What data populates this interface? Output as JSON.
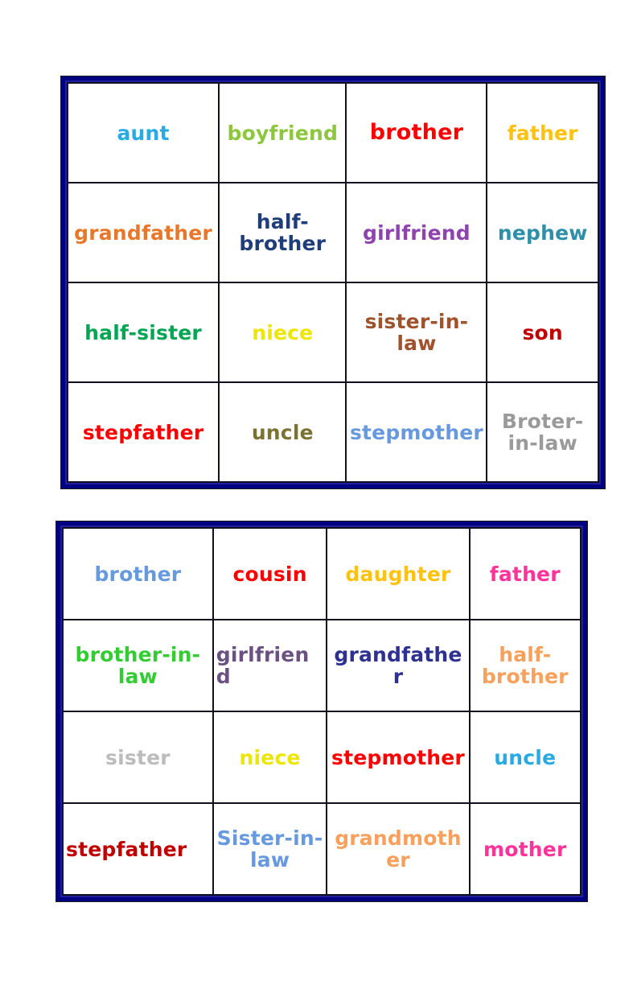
{
  "document": {
    "kind": "vocabulary-bingo-cards",
    "background_color": "#ffffff",
    "card_border_color": "#000080",
    "cell_border_color": "#101020"
  },
  "cards": [
    {
      "id": "card-1",
      "rows": [
        [
          {
            "text": "aunt",
            "color": "#29aae2",
            "align": "center",
            "size": "md"
          },
          {
            "text": "boyfriend",
            "color": "#8dc63f",
            "align": "center",
            "size": "md"
          },
          {
            "text": "brother",
            "color": "#ff0000",
            "align": "center",
            "size": "lg"
          },
          {
            "text": "father",
            "color": "#ffc20e",
            "align": "center",
            "size": "md"
          }
        ],
        [
          {
            "text": "grandfather",
            "color": "#e8772a",
            "align": "center",
            "size": "md"
          },
          {
            "text": "half-brother",
            "color": "#1f3d7a",
            "align": "center",
            "size": "md"
          },
          {
            "text": "girlfriend",
            "color": "#8e44ad",
            "align": "center",
            "size": "md"
          },
          {
            "text": "nephew",
            "color": "#2e8fa8",
            "align": "center",
            "size": "md"
          }
        ],
        [
          {
            "text": "half-sister",
            "color": "#00a651",
            "align": "center",
            "size": "md"
          },
          {
            "text": "niece",
            "color": "#ede600",
            "align": "center",
            "size": "md"
          },
          {
            "text": "sister-in-law",
            "color": "#a0522d",
            "align": "center",
            "size": "md"
          },
          {
            "text": "son",
            "color": "#c00000",
            "align": "center",
            "size": "md"
          }
        ],
        [
          {
            "text": "stepfather",
            "color": "#ff0000",
            "align": "center",
            "size": "md"
          },
          {
            "text": "uncle",
            "color": "#7a7333",
            "align": "center",
            "size": "md"
          },
          {
            "text": "stepmother",
            "color": "#6699dd",
            "align": "center",
            "size": "md"
          },
          {
            "text": "Broter-in-law",
            "color": "#9a9a9a",
            "align": "center",
            "size": "md"
          }
        ]
      ]
    },
    {
      "id": "card-2",
      "rows": [
        [
          {
            "text": "brother",
            "color": "#6699dd",
            "align": "center",
            "size": "md"
          },
          {
            "text": "cousin",
            "color": "#ff0000",
            "align": "center",
            "size": "md"
          },
          {
            "text": "daughter",
            "color": "#ffc20e",
            "align": "center",
            "size": "md"
          },
          {
            "text": "father",
            "color": "#ff3399",
            "align": "center",
            "size": "md"
          }
        ],
        [
          {
            "text": "brother-in-law",
            "color": "#33cc33",
            "align": "center",
            "size": "md"
          },
          {
            "text": "girlfriend",
            "color": "#6a5182",
            "align": "left",
            "size": "md"
          },
          {
            "text": "grandfather",
            "color": "#2e3192",
            "align": "center",
            "size": "md"
          },
          {
            "text": "half-brother",
            "color": "#f9a05c",
            "align": "center",
            "size": "md"
          }
        ],
        [
          {
            "text": "sister",
            "color": "#bcbcbc",
            "align": "center",
            "size": "md"
          },
          {
            "text": "niece",
            "color": "#ede600",
            "align": "center",
            "size": "md"
          },
          {
            "text": "stepmother",
            "color": "#ff0000",
            "align": "center",
            "size": "md"
          },
          {
            "text": "uncle",
            "color": "#29aae2",
            "align": "center",
            "size": "md"
          }
        ],
        [
          {
            "text": "stepfather",
            "color": "#c00000",
            "align": "left",
            "size": "md"
          },
          {
            "text": "Sister-in-law",
            "color": "#6699dd",
            "align": "center",
            "size": "md"
          },
          {
            "text": "grandmother",
            "color": "#f9a05c",
            "align": "center",
            "size": "md"
          },
          {
            "text": "mother",
            "color": "#ff3399",
            "align": "center",
            "size": "md"
          }
        ]
      ]
    }
  ]
}
